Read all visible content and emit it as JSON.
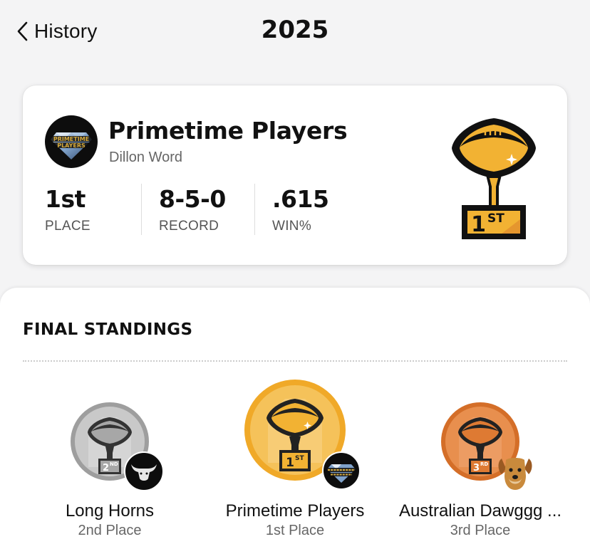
{
  "header": {
    "back_label": "History",
    "title": "2025"
  },
  "champion": {
    "team_name": "Primetime Players",
    "owner": "Dillon Word",
    "logo_text_line1": "PRIMETIME",
    "logo_text_line2": "PLAYERS",
    "trophy_place_number": "1",
    "trophy_place_suffix": "ST",
    "stats": [
      {
        "value": "1st",
        "label": "PLACE"
      },
      {
        "value": "8-5-0",
        "label": "RECORD"
      },
      {
        "value": ".615",
        "label": "WIN%"
      }
    ]
  },
  "standings": {
    "title": "FINAL STANDINGS",
    "entries": [
      {
        "team": "Long Horns",
        "place": "2nd Place",
        "badge_number": "2",
        "badge_suffix": "ND",
        "medal": "silver",
        "color": "#a7a7a7",
        "avatar": "bull-icon"
      },
      {
        "team": "Primetime Players",
        "place": "1st Place",
        "badge_number": "1",
        "badge_suffix": "ST",
        "medal": "gold",
        "color": "#f2b233",
        "avatar": "diamond-logo"
      },
      {
        "team": "Australian Dawggg ...",
        "place": "3rd Place",
        "badge_number": "3",
        "badge_suffix": "RD",
        "medal": "bronze",
        "color": "#de7a33",
        "avatar": "dog-icon"
      }
    ]
  },
  "colors": {
    "gold": "#f2b233",
    "silver": "#a7a7a7",
    "bronze": "#de7a33",
    "trophy_outline": "#111111"
  }
}
